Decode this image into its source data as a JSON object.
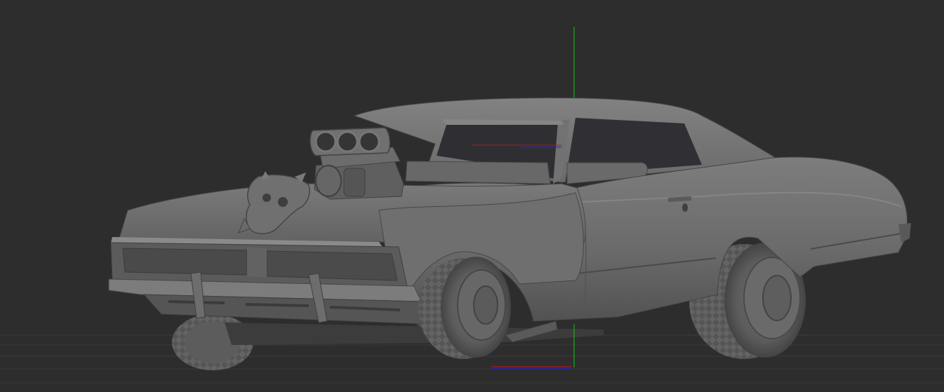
{
  "viewport": {
    "background_color": "#2d2d2d",
    "floor_grid_color": "#3a3a3a",
    "axis_colors": {
      "x": "#d01818",
      "y": "#19c419",
      "z": "#2222ff"
    },
    "model": {
      "subject": "car-model",
      "material_color": "#6e6e6e",
      "tire_color": "#555555"
    }
  }
}
